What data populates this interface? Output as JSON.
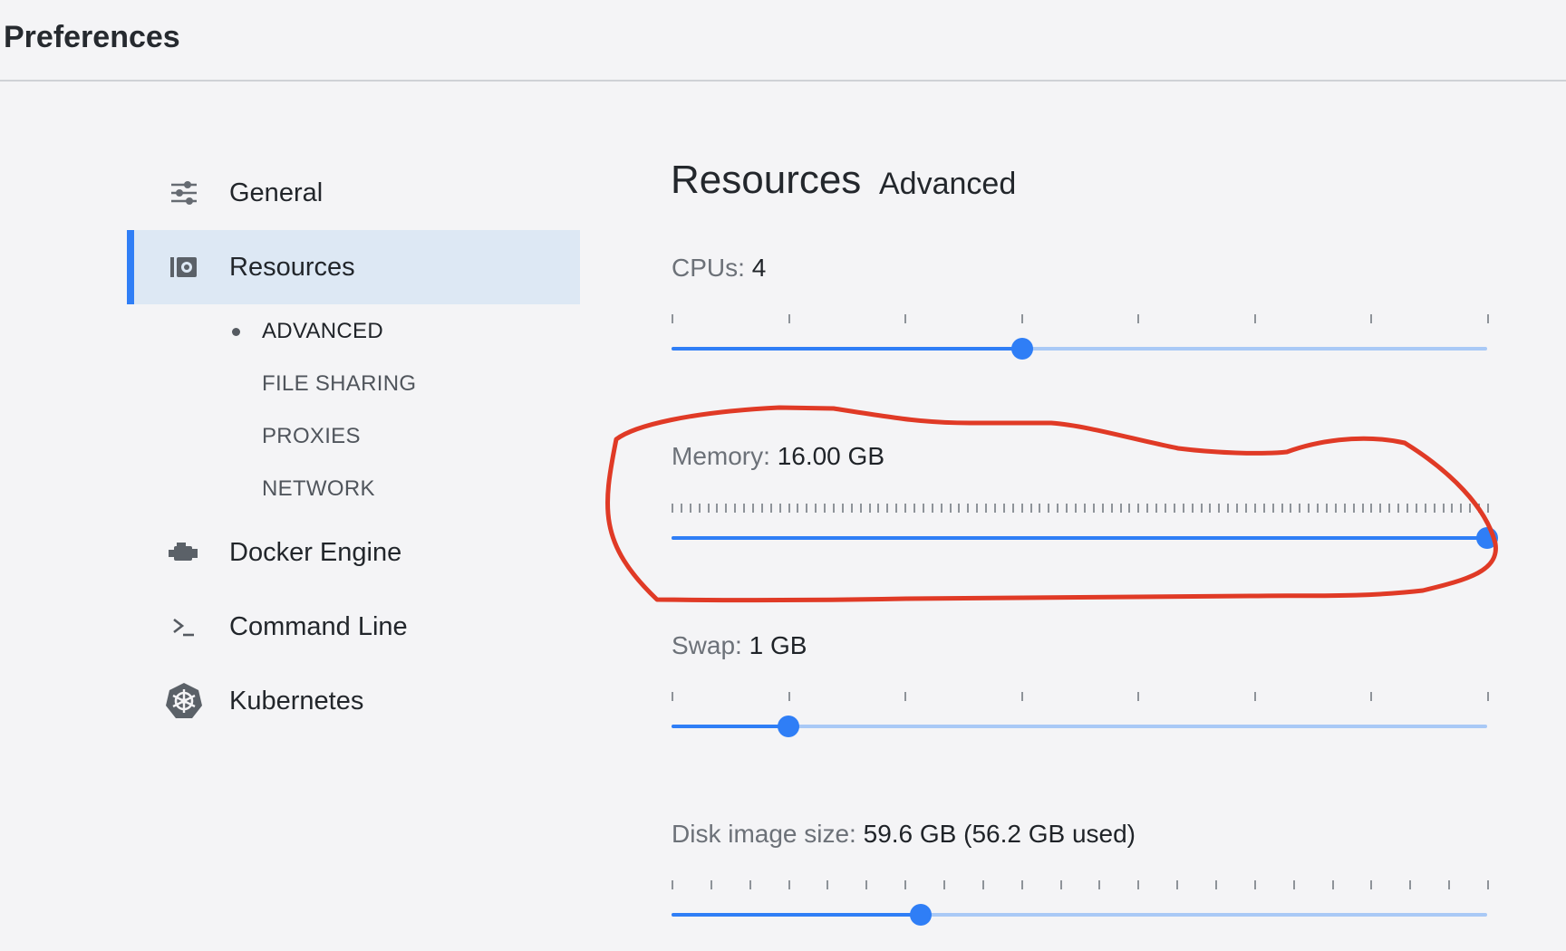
{
  "window": {
    "title": "Preferences"
  },
  "sidebar": {
    "items": [
      {
        "label": "General",
        "icon": "sliders-icon"
      },
      {
        "label": "Resources",
        "icon": "resources-icon",
        "active": true
      },
      {
        "label": "Docker Engine",
        "icon": "engine-icon"
      },
      {
        "label": "Command Line",
        "icon": "terminal-icon"
      },
      {
        "label": "Kubernetes",
        "icon": "kubernetes-icon"
      }
    ],
    "subitems": [
      {
        "label": "ADVANCED",
        "current": true
      },
      {
        "label": "FILE SHARING"
      },
      {
        "label": "PROXIES"
      },
      {
        "label": "NETWORK"
      }
    ]
  },
  "main": {
    "heading": "Resources",
    "subheading": "Advanced",
    "cpus": {
      "label": "CPUs:",
      "value": "4",
      "fraction": 0.43
    },
    "memory": {
      "label": "Memory:",
      "value": "16.00 GB",
      "fraction": 1.0
    },
    "swap": {
      "label": "Swap:",
      "value": "1 GB",
      "fraction": 0.143
    },
    "disk": {
      "label": "Disk image size:",
      "value": "59.6 GB (56.2 GB used)",
      "fraction": 0.306
    }
  },
  "colors": {
    "accent": "#2f7ef6",
    "track": "#a9c9f6",
    "annotation": "#e03a26",
    "active_bg": "#dde8f4"
  }
}
